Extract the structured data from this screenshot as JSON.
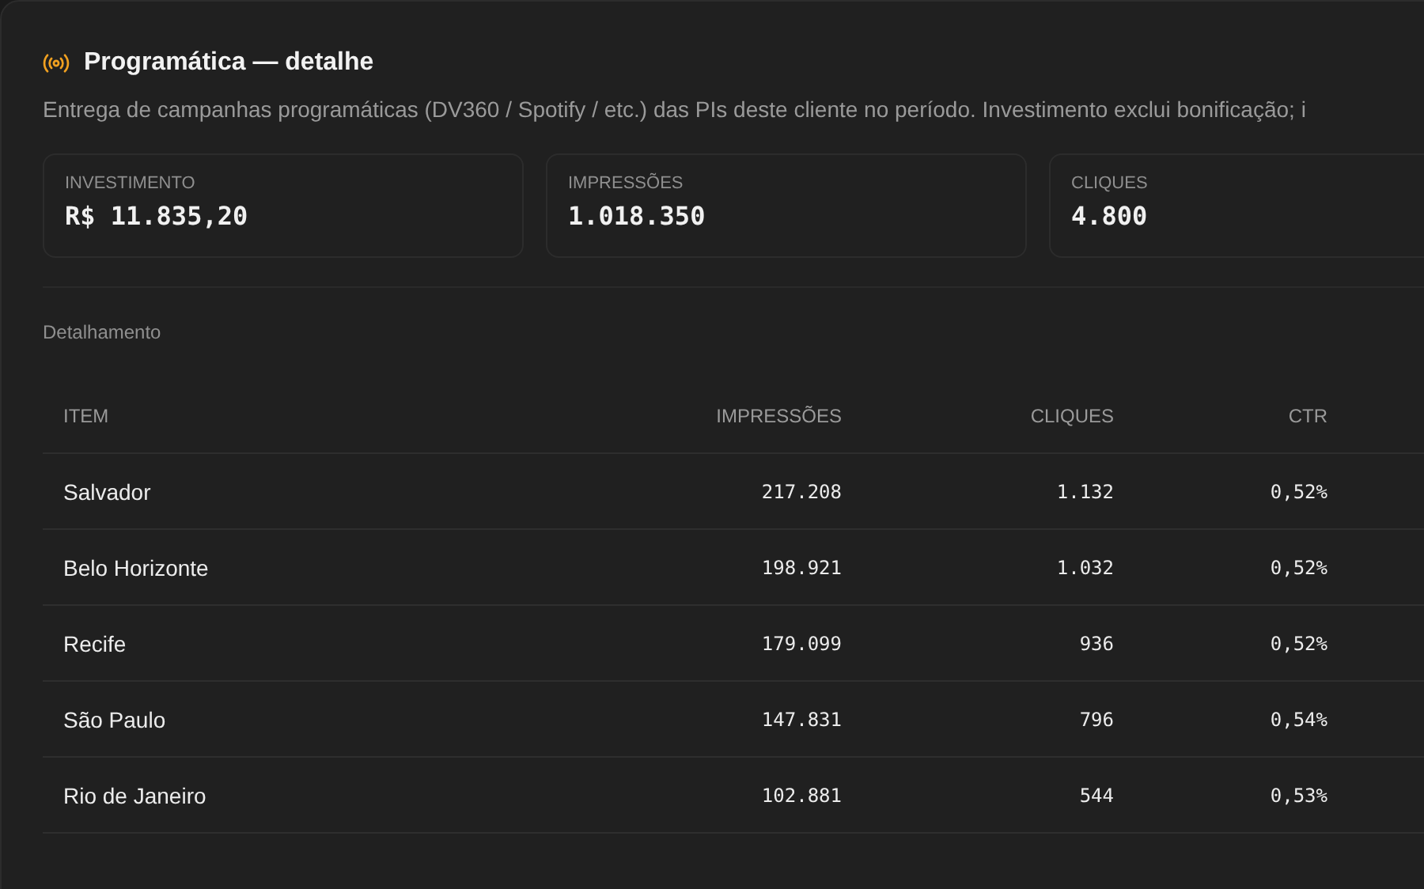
{
  "header": {
    "title": "Programática — detalhe",
    "description": "Entrega de campanhas programáticas (DV360 / Spotify / etc.) das PIs deste cliente no período. Investimento exclui bonificação; i"
  },
  "metrics": [
    {
      "label": "INVESTIMENTO",
      "value": "R$ 11.835,20"
    },
    {
      "label": "IMPRESSÕES",
      "value": "1.018.350"
    },
    {
      "label": "CLIQUES",
      "value": "4.800"
    }
  ],
  "section_title": "Detalhamento",
  "table": {
    "columns": [
      "ITEM",
      "IMPRESSÕES",
      "CLIQUES",
      "CTR"
    ],
    "rows": [
      [
        "Salvador",
        "217.208",
        "1.132",
        "0,52%"
      ],
      [
        "Belo Horizonte",
        "198.921",
        "1.032",
        "0,52%"
      ],
      [
        "Recife",
        "179.099",
        "936",
        "0,52%"
      ],
      [
        "São Paulo",
        "147.831",
        "796",
        "0,54%"
      ],
      [
        "Rio de Janeiro",
        "102.881",
        "544",
        "0,53%"
      ]
    ]
  }
}
